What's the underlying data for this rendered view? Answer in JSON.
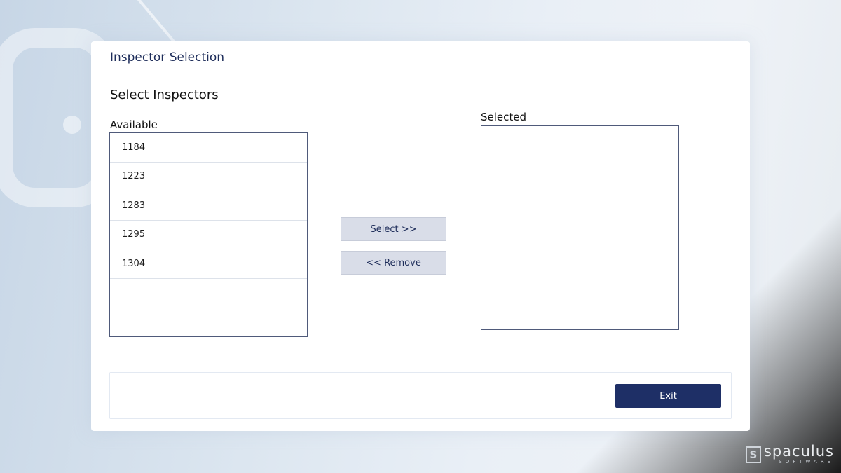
{
  "header": {
    "title": "Inspector Selection"
  },
  "section": {
    "title": "Select Inspectors"
  },
  "available": {
    "label": "Available",
    "items": [
      "1184",
      "1223",
      "1283",
      "1295",
      "1304"
    ]
  },
  "selected": {
    "label": "Selected",
    "items": []
  },
  "actions": {
    "select_label": "Select >>",
    "remove_label": "<< Remove"
  },
  "footer": {
    "exit_label": "Exit"
  },
  "watermark": {
    "brand": "spaculus",
    "sub": "SOFTWARE",
    "mark": "S"
  },
  "colors": {
    "primary": "#1e2f66",
    "secondary_button": "#d9dde8",
    "title_text": "#1e2d5a"
  }
}
